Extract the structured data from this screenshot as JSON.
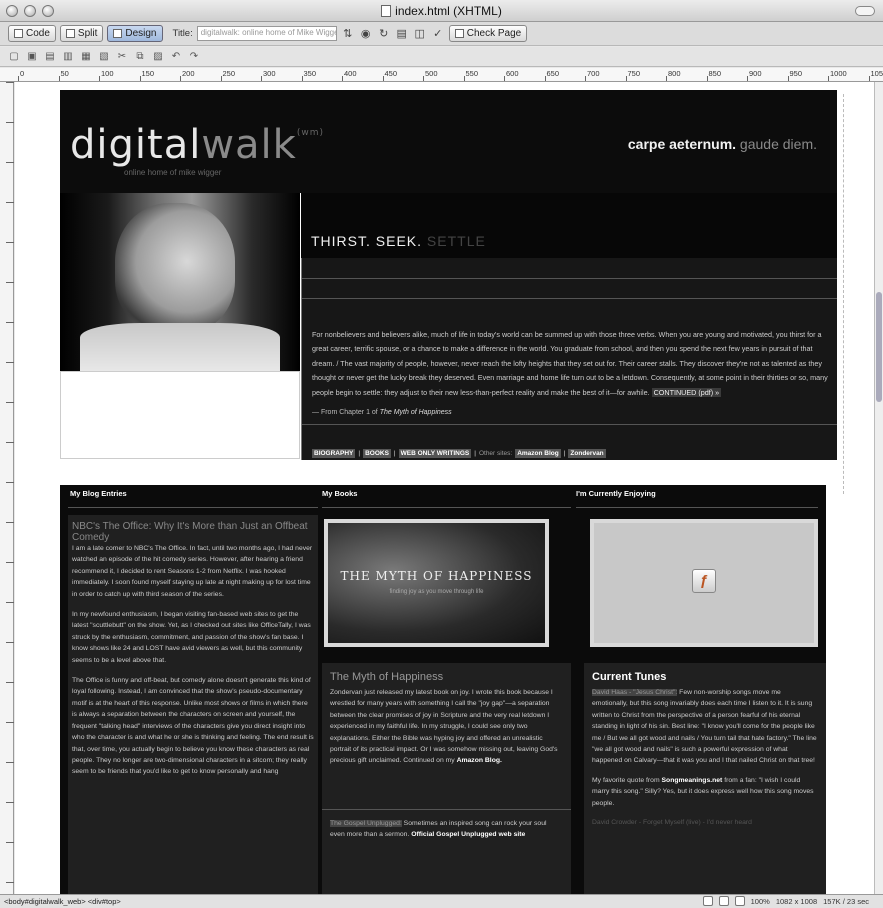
{
  "window": {
    "title": "index.html (XHTML)"
  },
  "toolbar": {
    "code_label": "Code",
    "split_label": "Split",
    "design_label": "Design",
    "title_label": "Title:",
    "title_value": "digitalwalk: online home of Mike Wigger",
    "check_page_label": "Check Page"
  },
  "ruler": {
    "marks": [
      "0",
      "50",
      "100",
      "150",
      "200",
      "250",
      "300",
      "350",
      "400",
      "450",
      "500",
      "550",
      "600",
      "650",
      "700",
      "750",
      "800",
      "850",
      "900",
      "950",
      "1000",
      "1050"
    ]
  },
  "site": {
    "logo_a": "digital",
    "logo_b": "walk",
    "logo_sup": "(wm)",
    "tagline": "online home of mike wigger",
    "motto_a": "carpe aeternum.",
    "motto_b": " gaude diem.",
    "heading_a": "THIRST.",
    "heading_b": " SEEK.",
    "heading_c": " SETTLE",
    "intro_text": "For nonbelievers and believers alike, much of life in today's world can be summed up with those three verbs. When you are young and motivated, you thirst for a great career, terrific spouse, or a chance to make a difference in the world. You graduate from school, and then you spend the next few years in pursuit of that dream. / The vast majority of people, however, never reach the lofty heights that they set out for. Their career stalls. They discover they're not as talented as they thought or never get the lucky break they deserved. Even marriage and home life turn out to be a letdown. Consequently, at some point in their thirties or so, many people begin to settle: they adjust to their new less-than-perfect reality and make the best of it—for awhile.",
    "continued_link": "CONTINUED (pdf) »",
    "chapter_prefix": "— From Chapter 1 of ",
    "chapter_book": "The Myth of Happiness",
    "nav": [
      "BIOGRAPHY",
      "BOOKS",
      "WEB ONLY WRITINGS"
    ],
    "other_sites_label": "Other sites:",
    "other_sites": [
      "Amazon Blog",
      "Zondervan"
    ]
  },
  "columns": {
    "blog_header": "My Blog Entries",
    "books_header": "My Books",
    "enjoying_header": "I'm Currently Enjoying",
    "blog_title": "NBC's The Office: Why It's More than Just an Offbeat Comedy",
    "blog_p1": "I am a late comer to NBC's The Office. In fact, until two months ago, I had never watched an episode of the hit comedy series. However, after hearing a friend recommend it, I decided to rent Seasons 1-2 from Netflix. I was hooked immediately. I soon found myself staying up late at night making up for lost time in order to catch up with third season of the series.",
    "blog_p2": "In my newfound enthusiasm, I began visiting fan-based web sites to get the latest \"scuttlebutt\" on the show. Yet, as I checked out sites like OfficeTally, I was struck by the enthusiasm, commitment, and passion of the show's fan base. I know shows like 24 and LOST have avid viewers as well, but this community seems to be a level above that.",
    "blog_p3": "The Office is funny and off-beat, but comedy alone doesn't generate this kind of loyal following. Instead, I am convinced that the show's pseudo-documentary motif is at the heart of this response. Unlike most shows or films in which there is always a separation between the characters on screen and yourself, the frequent \"talking head\" interviews of the characters give you direct insight into who the character is and what he or she is thinking and feeling. The end result is that, over time, you actually begin to believe you know these characters as real people. They no longer are two-dimensional characters in a sitcom; they really seem to be friends that you'd like to get to know personally and hang",
    "book_cover_title": "THE MYTH OF HAPPINESS",
    "book_cover_sub": "finding joy as you move through life",
    "book_heading": "The Myth of Happiness",
    "book_text": "Zondervan just released my latest book on joy. I wrote this book because I wrestled for many years with something I call the \"joy gap\"—a separation between the clear promises of joy in Scripture and the very real letdown I experienced in my faithful life. In my struggle, I could see only two explanations. Either the Bible was hyping joy and offered an unrealistic portrait of its practical impact. Or I was somehow missing out, leaving God's precious gift unclaimed. Continued on my",
    "book_link": "Amazon Blog.",
    "gospel_hl": "The Gospel Unplugged:",
    "gospel_text": " Sometimes an inspired song can rock your soul even more than a sermon.",
    "gospel_link": "Official Gospel Unplugged web site",
    "tunes_heading": "Current Tunes",
    "tunes_hl": "David Haas - \"Jesus Christ\":",
    "tunes_p1": " Few non-worship songs move me emotionally, but this song invariably does each time I listen to it. It is sung written to Christ from the perspective of a person fearful of his eternal standing in light of his sin. Best line: \"I know you'll come for the people like me / But we all got wood and nails / You turn tail that hate factory.\" The line \"we all got wood and nails\" is such a powerful expression of what happened on Calvary—that it was you and I that nailed Christ on that tree!",
    "tunes_p2a": "My favorite quote from ",
    "tunes_p2_link": "Songmeanings.net",
    "tunes_p2b": " from a fan: \"I wish I could marry this song.\" Silly? Yes, but it does express well how this song moves people.",
    "tunes_fade": "David Crowder - Forget Myself (live) - I'd never heard"
  },
  "status": {
    "tags": "<body#digitalwalk_web> <div#top>",
    "zoom": "100%",
    "dims": "1082 x 1008",
    "size": "157K / 23 sec"
  }
}
